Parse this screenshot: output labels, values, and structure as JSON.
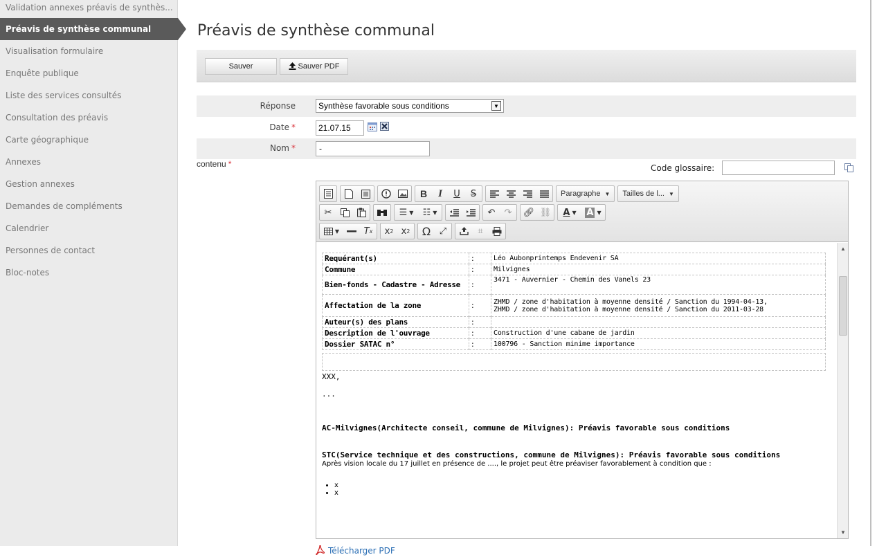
{
  "sidebar": {
    "items": [
      {
        "label": "Validation annexes préavis de synthès..."
      },
      {
        "label": "Préavis de synthèse communal"
      },
      {
        "label": "Visualisation formulaire"
      },
      {
        "label": "Enquête publique"
      },
      {
        "label": "Liste des services consultés"
      },
      {
        "label": "Consultation des préavis"
      },
      {
        "label": "Carte géographique"
      },
      {
        "label": "Annexes"
      },
      {
        "label": "Gestion annexes"
      },
      {
        "label": "Demandes de compléments"
      },
      {
        "label": "Calendrier"
      },
      {
        "label": "Personnes de contact"
      },
      {
        "label": "Bloc-notes"
      }
    ]
  },
  "page": {
    "title": "Préavis de synthèse communal"
  },
  "toolbar": {
    "save_label": "Sauver",
    "save_pdf_label": "Sauver PDF"
  },
  "form": {
    "reponse_label": "Réponse",
    "reponse_value": "Synthèse favorable sous conditions",
    "date_label": "Date",
    "date_value": "21.07.15",
    "nom_label": "Nom",
    "nom_value": "-",
    "contenu_label": "contenu",
    "required_mark": "*",
    "glossaire_label": "Code glossaire:"
  },
  "editor": {
    "paragraph_combo": "Paragraphe",
    "size_combo": "Tailles de l...",
    "table": [
      {
        "key": "Requérant(s)",
        "sep": ":",
        "value": "Léo Aubonprintemps Endevenir SA"
      },
      {
        "key": "Commune",
        "sep": ":",
        "value": "Milvignes"
      },
      {
        "key": "Bien-fonds - Cadastre - Adresse",
        "sep": ":",
        "value": "3471 - Auvernier - Chemin des Vanels 23"
      },
      {
        "key": "Affectation de la zone",
        "sep": ":",
        "value": "ZHMD / zone d'habitation à moyenne densité / Sanction du 1994-04-13,",
        "value2": "ZHMD / zone d'habitation à moyenne densité / Sanction du 2011-03-28"
      },
      {
        "key": "Auteur(s) des plans",
        "sep": ":",
        "value": ""
      },
      {
        "key": "Description de l'ouvrage",
        "sep": ":",
        "value": "Construction d'une cabane de jardin"
      },
      {
        "key": "Dossier SATAC n°",
        "sep": ":",
        "value": "100796 - Sanction minime importance"
      }
    ],
    "line_xxx": "XXX,",
    "line_dots": "...",
    "ac_line": "AC-Milvignes(Architecte conseil, commune de Milvignes): Préavis favorable sous conditions",
    "stc_line": "STC(Service technique et des constructions, commune de Milvignes): Préavis favorable sous conditions",
    "stc_detail": "Après vision locale du 17 juillet en présence de ...., le projet peut être préaviser favorablement à condition que :",
    "bullets": [
      "x",
      "x"
    ]
  },
  "download": {
    "label": "Télécharger PDF"
  },
  "colors": {
    "active_bg": "#5a5a5a",
    "sidebar_bg": "#ebebeb",
    "required": "#d9363e",
    "link": "#2c6fb5"
  }
}
